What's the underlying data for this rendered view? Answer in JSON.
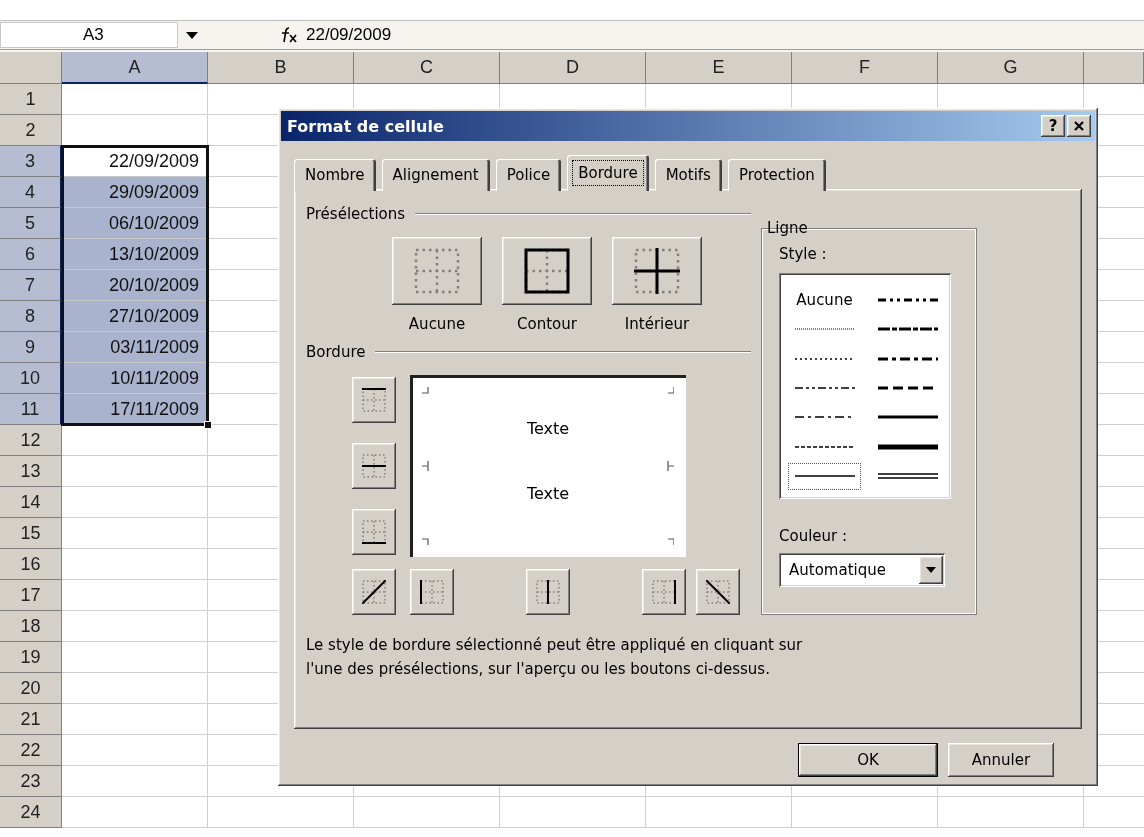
{
  "formula_bar": {
    "name_box": "A3",
    "formula": "22/09/2009"
  },
  "columns": [
    {
      "label": "A",
      "selected": true
    },
    {
      "label": "B",
      "selected": false
    },
    {
      "label": "C",
      "selected": false
    },
    {
      "label": "D",
      "selected": false
    },
    {
      "label": "E",
      "selected": false
    },
    {
      "label": "F",
      "selected": false
    },
    {
      "label": "G",
      "selected": false
    },
    {
      "selected": false
    }
  ],
  "rows": [
    {
      "label": "1",
      "selected": false
    },
    {
      "label": "2",
      "selected": false
    },
    {
      "label": "3",
      "selected": true,
      "cell": {
        "value": "22/09/2009",
        "active": true
      }
    },
    {
      "label": "4",
      "selected": true,
      "cell": {
        "value": "29/09/2009",
        "active": false
      }
    },
    {
      "label": "5",
      "selected": true,
      "cell": {
        "value": "06/10/2009",
        "active": false
      }
    },
    {
      "label": "6",
      "selected": true,
      "cell": {
        "value": "13/10/2009",
        "active": false
      }
    },
    {
      "label": "7",
      "selected": true,
      "cell": {
        "value": "20/10/2009",
        "active": false
      }
    },
    {
      "label": "8",
      "selected": true,
      "cell": {
        "value": "27/10/2009",
        "active": false
      }
    },
    {
      "label": "9",
      "selected": true,
      "cell": {
        "value": "03/11/2009",
        "active": false
      }
    },
    {
      "label": "10",
      "selected": true,
      "cell": {
        "value": "10/11/2009",
        "active": false
      }
    },
    {
      "label": "11",
      "selected": true,
      "cell": {
        "value": "17/11/2009",
        "active": false
      }
    },
    {
      "label": "12",
      "selected": false
    },
    {
      "label": "13",
      "selected": false
    },
    {
      "label": "14",
      "selected": false
    },
    {
      "label": "15",
      "selected": false
    },
    {
      "label": "16",
      "selected": false
    },
    {
      "label": "17",
      "selected": false
    },
    {
      "label": "18",
      "selected": false
    },
    {
      "label": "19",
      "selected": false
    },
    {
      "label": "20",
      "selected": false
    },
    {
      "label": "21",
      "selected": false
    },
    {
      "label": "22",
      "selected": false
    },
    {
      "label": "23",
      "selected": false
    },
    {
      "label": "24",
      "selected": false
    }
  ],
  "dialog": {
    "title": "Format de cellule",
    "help": "?",
    "tabs": [
      {
        "label": "Nombre",
        "selected": false
      },
      {
        "label": "Alignement",
        "selected": false
      },
      {
        "label": "Police",
        "selected": false
      },
      {
        "label": "Bordure",
        "selected": true
      },
      {
        "label": "Motifs",
        "selected": false
      },
      {
        "label": "Protection",
        "selected": false
      }
    ],
    "presets": {
      "heading": "Présélections",
      "items": [
        {
          "label": "Aucune",
          "kind": "none"
        },
        {
          "label": "Contour",
          "kind": "outline"
        },
        {
          "label": "Intérieur",
          "kind": "inside"
        }
      ]
    },
    "border": {
      "heading": "Bordure",
      "preview_texts": [
        "Texte",
        "Texte"
      ],
      "side_buttons": [
        {
          "kind": "top"
        },
        {
          "kind": "middle"
        },
        {
          "kind": "bottom"
        }
      ],
      "bottom_buttons": [
        {
          "kind": "diag_up"
        },
        {
          "kind": "left"
        },
        {
          "kind": "vertical"
        },
        {
          "kind": "right"
        },
        {
          "kind": "diag_down"
        }
      ]
    },
    "line": {
      "heading": "Ligne",
      "style_label": "Style :",
      "color_label": "Couleur :",
      "color_value": "Automatique",
      "styles": [
        {
          "kind": "none",
          "label": "Aucune",
          "selected": false
        },
        {
          "kind": "hair",
          "selected": false
        },
        {
          "kind": "dotted",
          "selected": false
        },
        {
          "kind": "dashdotdot",
          "selected": false
        },
        {
          "kind": "dashdot",
          "selected": false
        },
        {
          "kind": "dashed",
          "selected": false
        },
        {
          "kind": "thin",
          "selected": true
        },
        {
          "kind": "medium_dashdotdot",
          "selected": false
        },
        {
          "kind": "slant_dashdot",
          "selected": false
        },
        {
          "kind": "medium_dashdot",
          "selected": false
        },
        {
          "kind": "medium_dashed",
          "selected": false
        },
        {
          "kind": "medium",
          "selected": false
        },
        {
          "kind": "thick",
          "selected": false
        },
        {
          "kind": "double",
          "selected": false
        }
      ]
    },
    "note": "Le style de bordure sélectionné peut être appliqué en cliquant sur\nl'une des présélections, sur l'aperçu ou les boutons ci-dessus.",
    "buttons": [
      {
        "label": "OK",
        "default": true
      },
      {
        "label": "Annuler",
        "default": false
      }
    ]
  }
}
